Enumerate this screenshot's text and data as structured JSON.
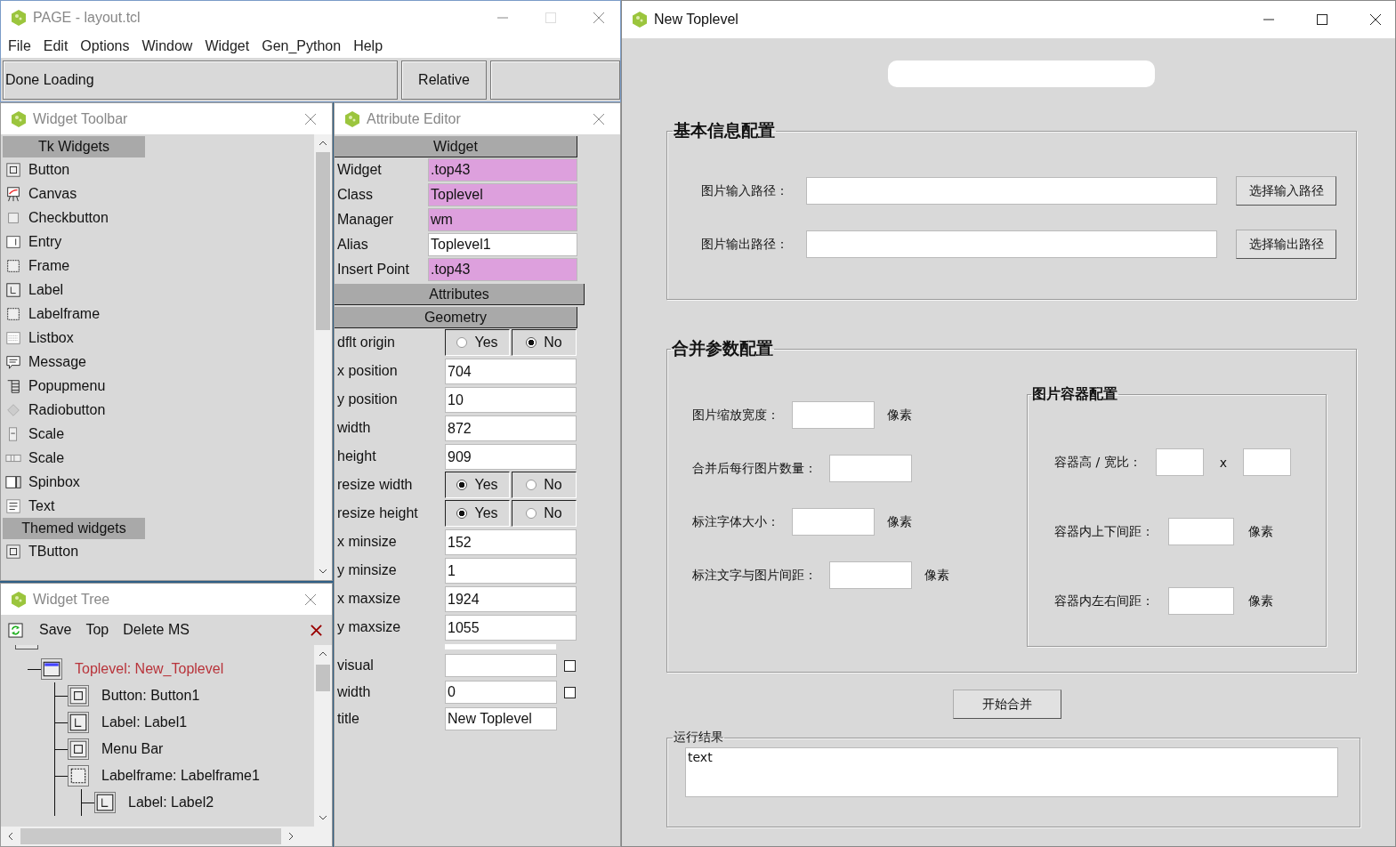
{
  "main_window": {
    "title": "PAGE - layout.tcl",
    "menu": [
      "File",
      "Edit",
      "Options",
      "Window",
      "Widget",
      "Gen_Python",
      "Help"
    ],
    "status": "Done Loading",
    "mode": "Relative"
  },
  "widget_toolbar": {
    "title": "Widget Toolbar",
    "sections": [
      {
        "heading": "Tk Widgets",
        "items": [
          "Button",
          "Canvas",
          "Checkbutton",
          "Entry",
          "Frame",
          "Label",
          "Labelframe",
          "Listbox",
          "Message",
          "Popupmenu",
          "Radiobutton",
          "Scale",
          "Scale",
          "Spinbox",
          "Text"
        ]
      },
      {
        "heading": "Themed widgets",
        "items": [
          "TButton"
        ]
      }
    ]
  },
  "widget_tree": {
    "title": "Widget Tree",
    "toolbar": [
      "Save",
      "Top",
      "Delete MS"
    ],
    "nodes": [
      {
        "label": "Toplevel: New_Toplevel",
        "selected": true,
        "children": [
          {
            "label": "Button: Button1",
            "selected": false
          },
          {
            "label": "Label: Label1",
            "selected": false
          },
          {
            "label": "Menu Bar",
            "selected": false
          },
          {
            "label": "Labelframe: Labelframe1",
            "selected": false,
            "children": [
              {
                "label": "Label: Label2",
                "selected": false
              }
            ]
          }
        ]
      }
    ]
  },
  "attribute_editor": {
    "title": "Attribute Editor",
    "widget_heading": "Widget",
    "widget_rows": [
      {
        "label": "Widget",
        "value": ".top43",
        "readonly": true
      },
      {
        "label": "Class",
        "value": "Toplevel",
        "readonly": true
      },
      {
        "label": "Manager",
        "value": "wm",
        "readonly": true
      },
      {
        "label": "Alias",
        "value": "Toplevel1",
        "readonly": false
      },
      {
        "label": "Insert Point",
        "value": ".top43",
        "readonly": true
      }
    ],
    "attributes_heading": "Attributes",
    "geometry_heading": "Geometry",
    "geometry_rows": [
      {
        "kind": "radio",
        "label": "dflt origin",
        "options": [
          {
            "label": "Yes",
            "selected": false
          },
          {
            "label": "No",
            "selected": true
          }
        ]
      },
      {
        "kind": "entry",
        "label": "x position",
        "value": "704"
      },
      {
        "kind": "entry",
        "label": "y position",
        "value": "10"
      },
      {
        "kind": "entry",
        "label": "width",
        "value": "872"
      },
      {
        "kind": "entry",
        "label": "height",
        "value": "909"
      },
      {
        "kind": "radio",
        "label": "resize width",
        "options": [
          {
            "label": "Yes",
            "selected": true
          },
          {
            "label": "No",
            "selected": false
          }
        ]
      },
      {
        "kind": "radio",
        "label": "resize height",
        "options": [
          {
            "label": "Yes",
            "selected": true
          },
          {
            "label": "No",
            "selected": false
          }
        ]
      },
      {
        "kind": "entry",
        "label": "x minsize",
        "value": "152"
      },
      {
        "kind": "entry",
        "label": "y minsize",
        "value": "1"
      },
      {
        "kind": "entry",
        "label": "x maxsize",
        "value": "1924"
      },
      {
        "kind": "entry",
        "label": "y maxsize",
        "value": "1055"
      }
    ],
    "extra_rows": [
      {
        "label": "visual",
        "checked": false
      },
      {
        "label": "width",
        "value": "0",
        "checked": false
      },
      {
        "label": "title",
        "value": "New Toplevel"
      }
    ]
  },
  "toplevel": {
    "title": "New Toplevel",
    "basic": {
      "title": "基本信息配置",
      "rows": [
        {
          "label": "图片输入路径：",
          "button": "选择输入路径"
        },
        {
          "label": "图片输出路径：",
          "button": "选择输出路径"
        }
      ]
    },
    "merge": {
      "title": "合并参数配置",
      "fields": [
        {
          "label": "图片缩放宽度：",
          "unit": "像素"
        },
        {
          "label": "合并后每行图片数量："
        },
        {
          "label": "标注字体大小：",
          "unit": "像素"
        },
        {
          "label": "标注文字与图片间距：",
          "unit": "像素"
        }
      ],
      "container": {
        "title": "图片容器配置",
        "rows": [
          {
            "kind": "ratio",
            "label": "容器高 / 宽比：",
            "separator": "x"
          },
          {
            "kind": "single",
            "label": "容器内上下间距：",
            "unit": "像素"
          },
          {
            "kind": "single",
            "label": "容器内左右间距：",
            "unit": "像素"
          }
        ]
      }
    },
    "start_button": "开始合并",
    "result": {
      "title": "运行结果",
      "text": "text"
    }
  }
}
